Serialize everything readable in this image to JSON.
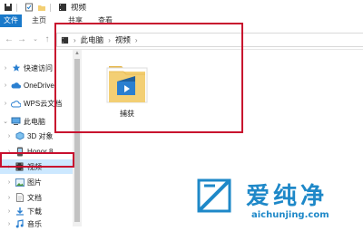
{
  "window": {
    "title": "视频"
  },
  "ribbon": {
    "tabs": [
      "文件",
      "主页",
      "共享",
      "查看"
    ]
  },
  "address": {
    "crumbs": [
      "此电脑",
      "视频"
    ]
  },
  "sidebar": {
    "items": [
      {
        "label": "快速访问",
        "icon": "star-icon"
      },
      {
        "label": "OneDrive",
        "icon": "cloud-icon"
      },
      {
        "label": "WPS云文档",
        "icon": "wps-cloud-icon"
      },
      {
        "label": "此电脑",
        "icon": "computer-icon"
      },
      {
        "label": "3D 对象",
        "icon": "cube-icon"
      },
      {
        "label": "Honor 8",
        "icon": "phone-icon"
      },
      {
        "label": "视频",
        "icon": "video-icon"
      },
      {
        "label": "图片",
        "icon": "picture-icon"
      },
      {
        "label": "文档",
        "icon": "document-icon"
      },
      {
        "label": "下载",
        "icon": "download-icon"
      },
      {
        "label": "音乐",
        "icon": "music-icon"
      }
    ]
  },
  "content": {
    "items": [
      {
        "label": "捕获",
        "icon": "video-folder-icon"
      }
    ]
  },
  "watermark": {
    "name": "爱纯净",
    "url": "aichunjing.com"
  },
  "colors": {
    "accent": "#1979ca",
    "highlight": "#c8102e",
    "watermark": "#1e88c8",
    "folder": "#f3cf74"
  }
}
